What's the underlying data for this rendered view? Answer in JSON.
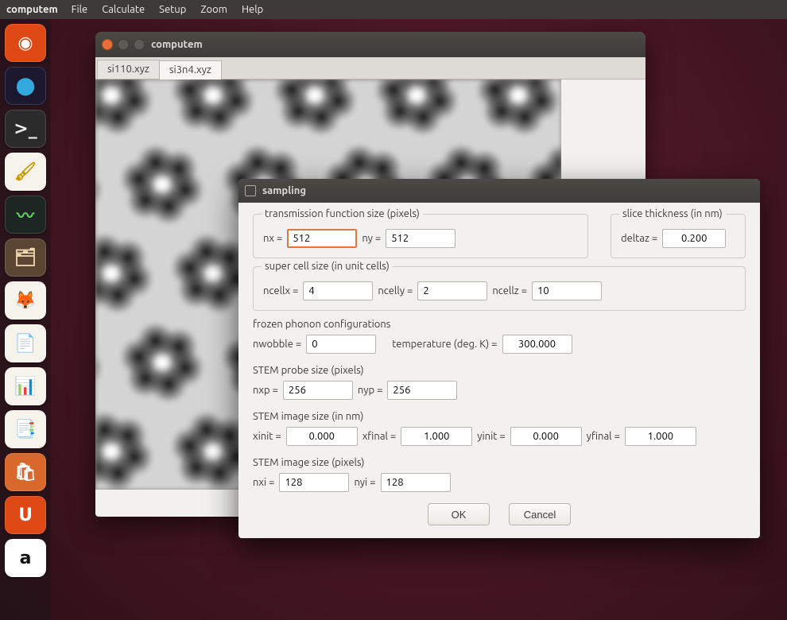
{
  "menubar": {
    "app": "computem",
    "items": [
      "File",
      "Calculate",
      "Setup",
      "Zoom",
      "Help"
    ]
  },
  "launcher": [
    {
      "name": "dash",
      "bg": "#dd4814",
      "glyph": "◉",
      "color": "#fff"
    },
    {
      "name": "atom-viewer",
      "bg": "#1b1830",
      "glyph": "⬤",
      "color": "#3ad"
    },
    {
      "name": "terminal",
      "bg": "#2b2b2b",
      "glyph": ">_",
      "color": "#eee"
    },
    {
      "name": "libreoffice-draw",
      "bg": "#f6f3ec",
      "glyph": "🖌",
      "color": "#c79a00"
    },
    {
      "name": "system-monitor",
      "bg": "#1e2623",
      "glyph": "〰",
      "color": "#6c6"
    },
    {
      "name": "files",
      "bg": "#5a4632",
      "glyph": "🗂",
      "color": "#f0d9b5"
    },
    {
      "name": "firefox",
      "bg": "#f6f3ec",
      "glyph": "🦊",
      "color": "#e66000"
    },
    {
      "name": "libreoffice-writer",
      "bg": "#f6f3ec",
      "glyph": "📄",
      "color": "#2a6099"
    },
    {
      "name": "libreoffice-calc",
      "bg": "#f6f3ec",
      "glyph": "📊",
      "color": "#2e8b1f"
    },
    {
      "name": "libreoffice-impress",
      "bg": "#f6f3ec",
      "glyph": "📑",
      "color": "#c75b12"
    },
    {
      "name": "software-center",
      "bg": "#d8682b",
      "glyph": "🛍",
      "color": "#fff"
    },
    {
      "name": "ubuntu-one",
      "bg": "#dd4814",
      "glyph": "U",
      "color": "#fff"
    },
    {
      "name": "amazon",
      "bg": "#ffffff",
      "glyph": "a",
      "color": "#111"
    }
  ],
  "computem_window": {
    "title": "computem",
    "tabs": [
      {
        "label": "si110.xyz",
        "active": false
      },
      {
        "label": "si3n4.xyz",
        "active": true
      }
    ]
  },
  "dialog": {
    "title": "sampling",
    "transmission": {
      "legend": "transmission function size (pixels)",
      "nx_label": "nx =",
      "nx": "512",
      "ny_label": "ny =",
      "ny": "512"
    },
    "slice": {
      "legend": "slice thickness (in nm)",
      "deltaz_label": "deltaz =",
      "deltaz": "0.200"
    },
    "supercell": {
      "legend": "super cell size (in unit cells)",
      "ncellx_label": "ncellx =",
      "ncellx": "4",
      "ncelly_label": "ncelly =",
      "ncelly": "2",
      "ncellz_label": "ncellz =",
      "ncellz": "10"
    },
    "phonon": {
      "heading": "frozen phonon configurations",
      "nwobble_label": "nwobble =",
      "nwobble": "0",
      "temp_label": "temperature (deg. K) =",
      "temp": "300.000"
    },
    "probe": {
      "heading": "STEM probe size (pixels)",
      "nxp_label": "nxp =",
      "nxp": "256",
      "nyp_label": "nyp =",
      "nyp": "256"
    },
    "imgnm": {
      "heading": "STEM image size (in nm)",
      "xinit_label": "xinit =",
      "xinit": "0.000",
      "xfinal_label": "xfinal =",
      "xfinal": "1.000",
      "yinit_label": "yinit =",
      "yinit": "0.000",
      "yfinal_label": "yfinal =",
      "yfinal": "1.000"
    },
    "imgpx": {
      "heading": "STEM image size (pixels)",
      "nxi_label": "nxi =",
      "nxi": "128",
      "nyi_label": "nyi =",
      "nyi": "128"
    },
    "buttons": {
      "ok": "OK",
      "cancel": "Cancel"
    }
  }
}
